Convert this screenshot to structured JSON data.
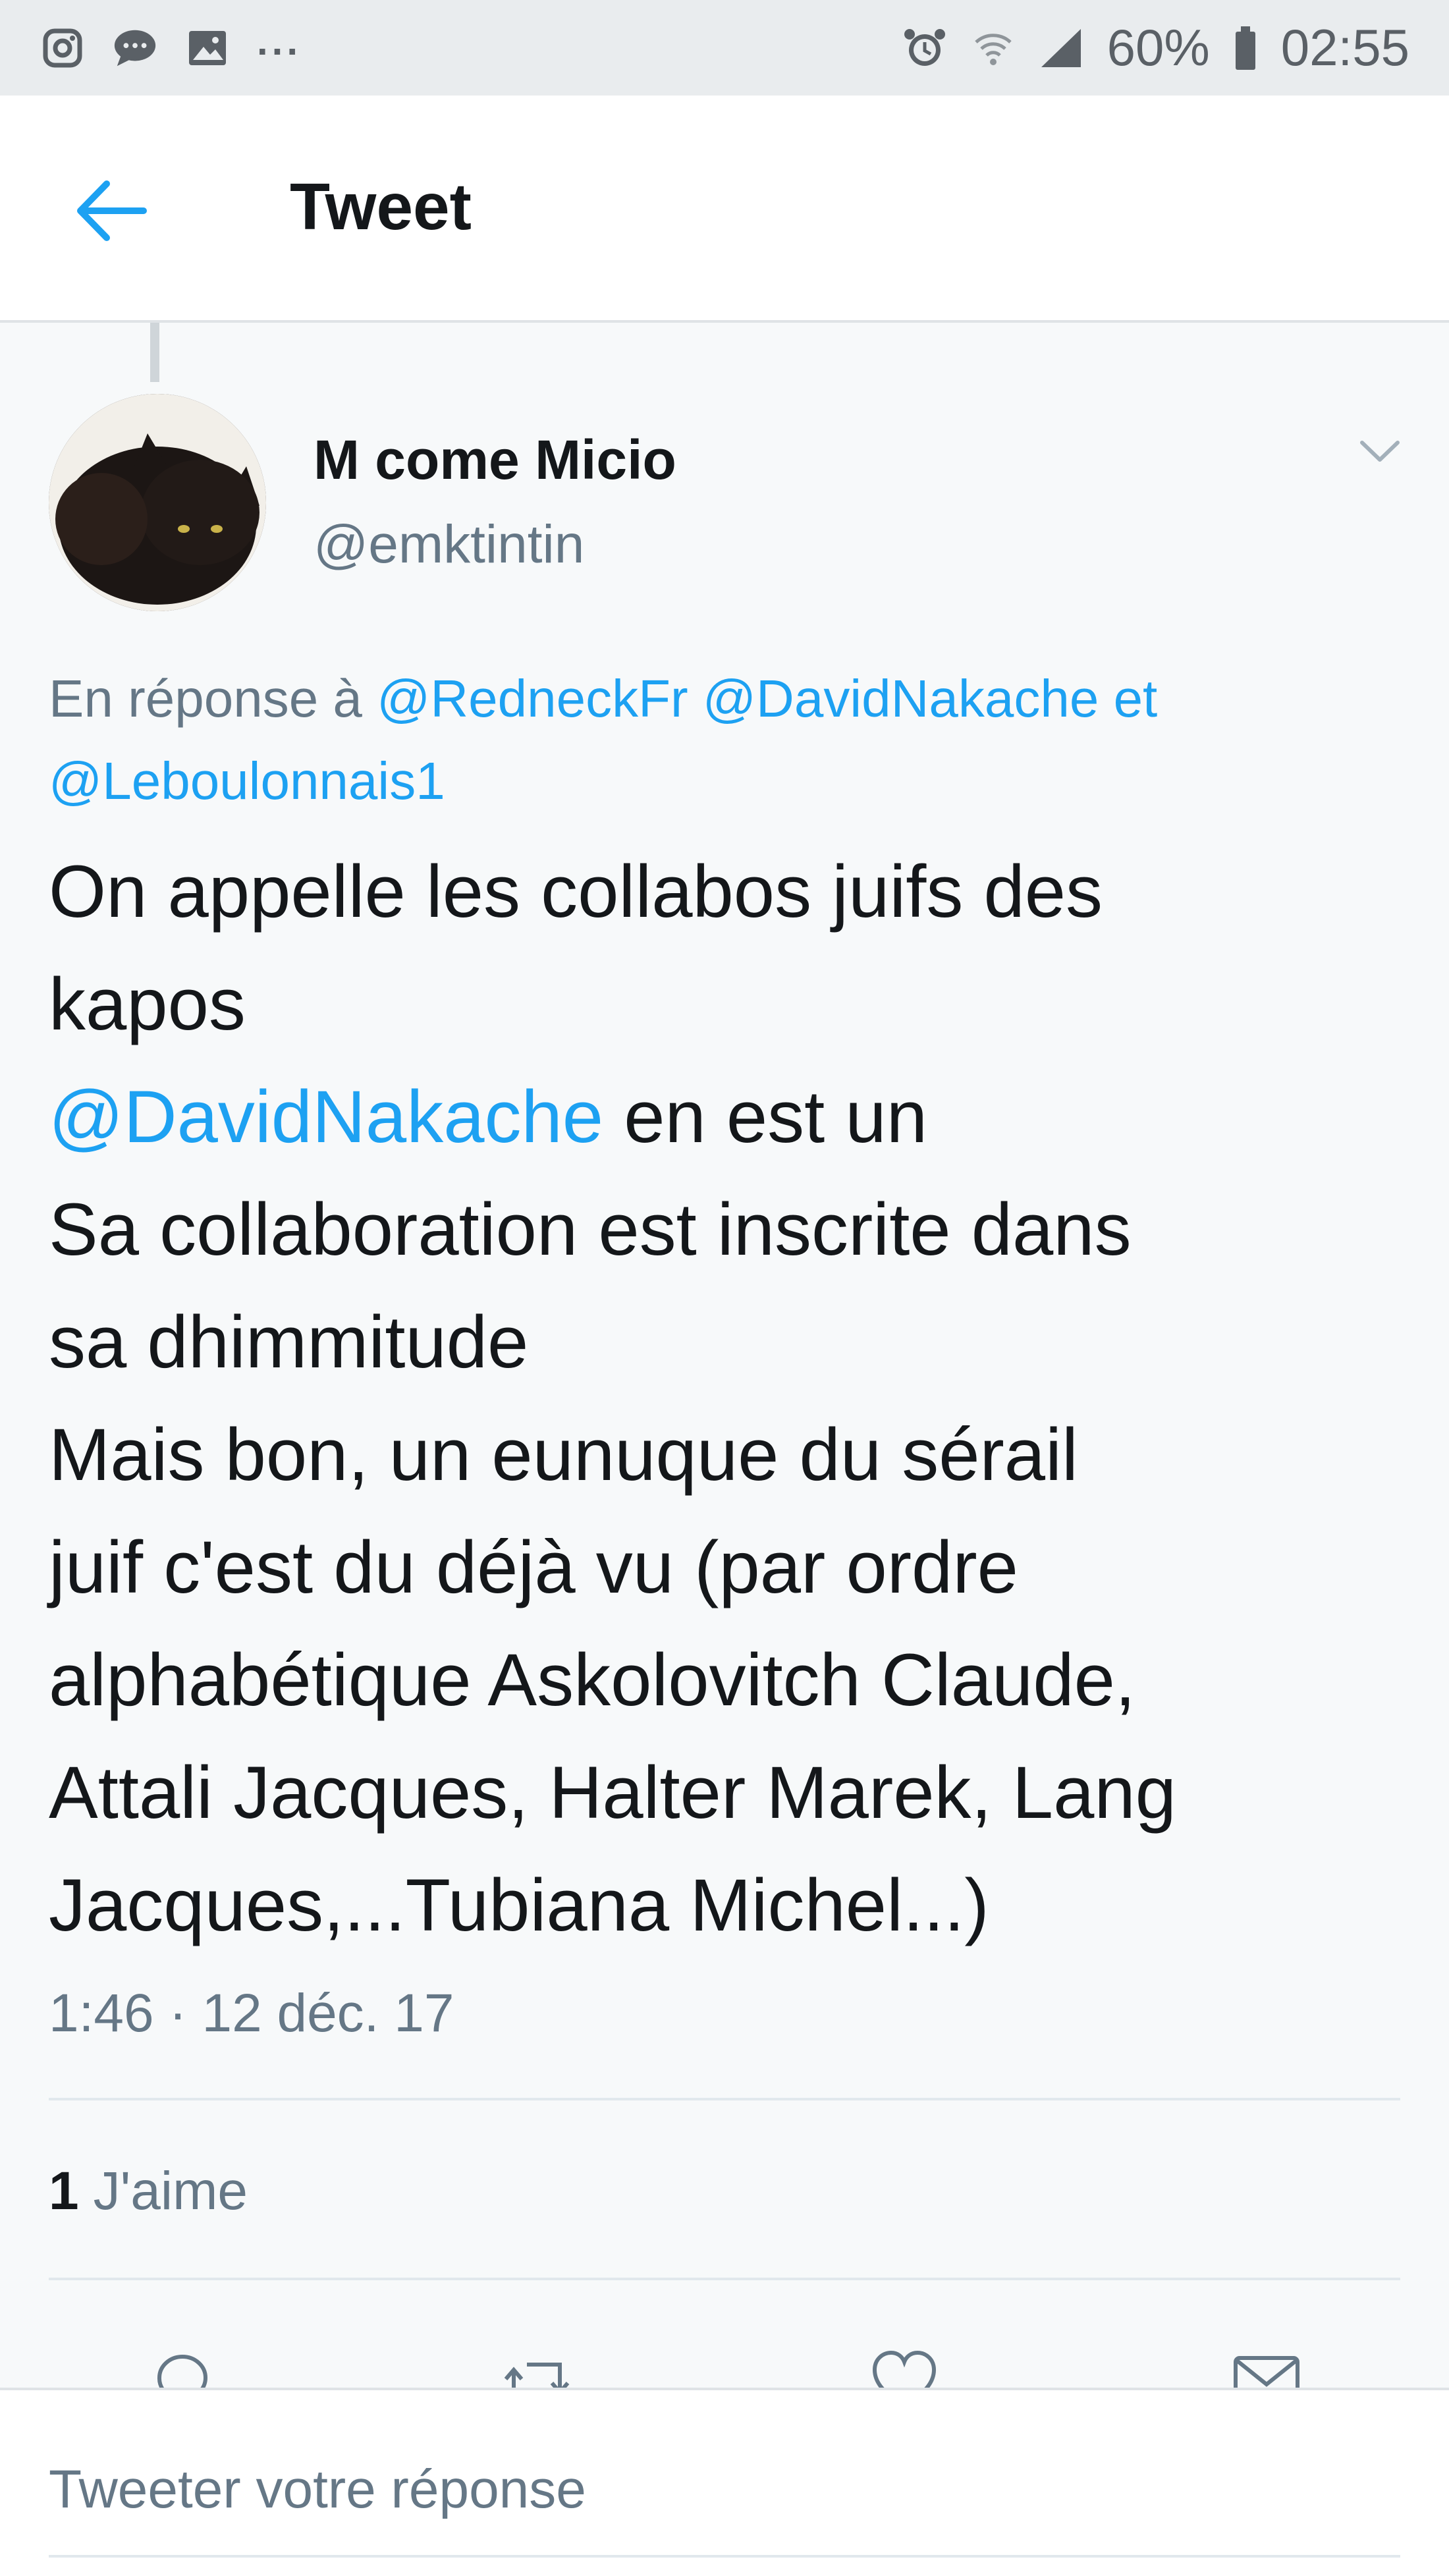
{
  "status_bar": {
    "left_icons": [
      "instagram-icon",
      "messages-icon",
      "gallery-icon"
    ],
    "overflow": "...",
    "right_icons": [
      "alarm-icon",
      "wifi-icon",
      "signal-icon",
      "battery-icon"
    ],
    "battery": "60%",
    "time": "02:55"
  },
  "header": {
    "back_icon": "back-arrow-icon",
    "title": "Tweet"
  },
  "tweet": {
    "author": {
      "display_name": "M come Micio",
      "handle": "@emktintin"
    },
    "reply_prefix": "En réponse à",
    "reply_mentions": [
      "@RedneckFr",
      "@DavidNakache"
    ],
    "reply_conjunction": "et",
    "reply_last_mention": "@Leboulonnais1",
    "body_lines": [
      "On appelle les collabos juifs des",
      "kapos",
      "Sa collaboration est inscrite dans",
      "sa dhimmitude",
      "Mais bon, un eunuque du sérail",
      "juif c'est du déjà vu (par ordre",
      "alphabétique Askolovitch Claude,",
      "Attali Jacques, Halter Marek, Lang",
      "Jacques,...Tubiana Michel...)"
    ],
    "inline_mention": "@DavidNakache",
    "inline_mention_suffix": " en est un",
    "timestamp": "1:46 · 12 déc. 17",
    "likes_count": "1",
    "likes_label": "J'aime"
  },
  "actions": [
    "reply-icon",
    "retweet-icon",
    "like-icon",
    "share-icon"
  ],
  "reply_bar": {
    "placeholder": "Tweeter votre réponse"
  },
  "colors": {
    "accent": "#1da1f2",
    "text": "#14171a",
    "secondary": "#657786",
    "background": "#f7f9fa"
  }
}
